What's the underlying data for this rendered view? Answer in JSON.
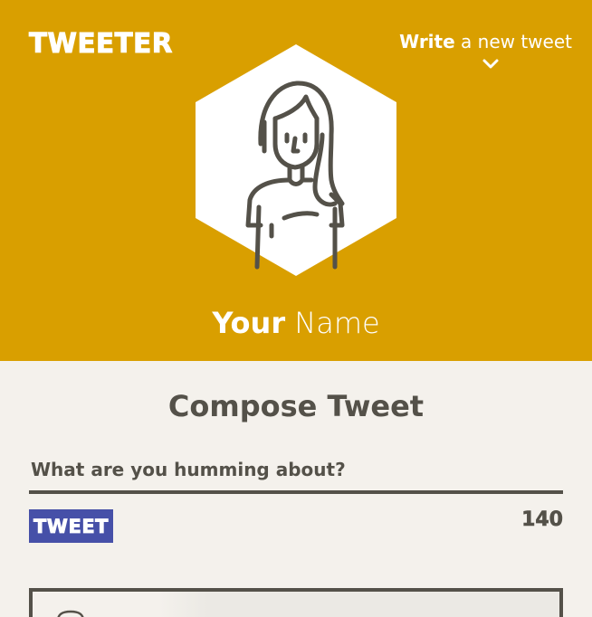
{
  "header": {
    "brand": "TWEETER",
    "write_strong": "Write",
    "write_rest": " a new tweet",
    "icons": {
      "toggle": "chevron-down-icon",
      "avatar": "user-avatar-icon"
    },
    "colors": {
      "background": "#d99f00",
      "text": "#ffffff"
    }
  },
  "profile": {
    "name_strong": "Your",
    "name_rest": " Name"
  },
  "compose": {
    "title": "Compose Tweet",
    "placeholder": "What are you humming about?",
    "button_label": "TWEET",
    "counter": "140",
    "colors": {
      "button": "#4650a8",
      "text": "#545149"
    }
  }
}
